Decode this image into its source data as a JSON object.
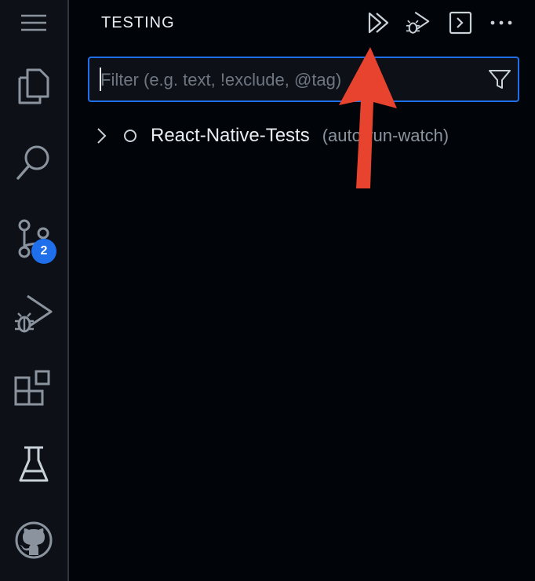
{
  "activity_bar": {
    "items": [
      {
        "name": "explorer",
        "icon": "files-icon"
      },
      {
        "name": "search",
        "icon": "search-icon"
      },
      {
        "name": "source-control",
        "icon": "source-control-icon",
        "badge": "2"
      },
      {
        "name": "run-debug",
        "icon": "run-debug-icon"
      },
      {
        "name": "extensions",
        "icon": "extensions-icon"
      },
      {
        "name": "testing",
        "icon": "flask-icon"
      },
      {
        "name": "github",
        "icon": "github-icon"
      }
    ]
  },
  "view": {
    "title": "TESTING",
    "toolbar": [
      "run-all-tests-icon",
      "debug-all-tests-icon",
      "show-output-icon",
      "more-actions-icon"
    ]
  },
  "filter": {
    "placeholder": "Filter (e.g. text, !exclude, @tag)",
    "value": ""
  },
  "tree": {
    "items": [
      {
        "label": "React-Native-Tests",
        "description": "(auto-run-watch)",
        "expanded": false,
        "status": "unset"
      }
    ]
  },
  "annotation": {
    "type": "red-arrow",
    "color": "#e8432e",
    "points_to": "run-all-tests-button"
  },
  "colors": {
    "accent": "#1f6feb",
    "badge": "#1f6feb",
    "arrow": "#e8432e"
  }
}
